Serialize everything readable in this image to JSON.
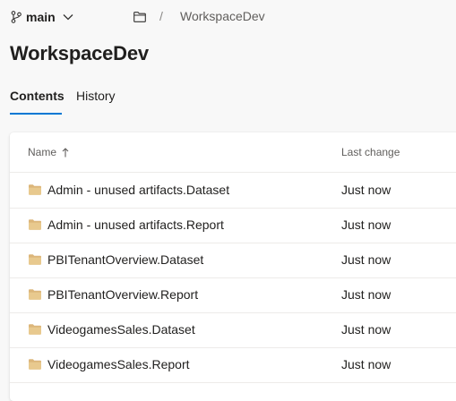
{
  "topbar": {
    "branch_icon": "git-branch-icon",
    "branch": "main",
    "branch_chevron_icon": "chevron-down-icon",
    "folder_icon": "folder-outline-icon",
    "separator": "/",
    "breadcrumb": "WorkspaceDev"
  },
  "page": {
    "title": "WorkspaceDev"
  },
  "tabs": [
    {
      "label": "Contents",
      "active": true
    },
    {
      "label": "History",
      "active": false
    }
  ],
  "table": {
    "columns": [
      {
        "label": "Name",
        "sort": "ascending",
        "sort_icon": "arrow-up-icon"
      },
      {
        "label": "Last change"
      }
    ],
    "rows": [
      {
        "icon": "folder-icon",
        "name": "Admin - unused artifacts.Dataset",
        "last_change": "Just now"
      },
      {
        "icon": "folder-icon",
        "name": "Admin - unused artifacts.Report",
        "last_change": "Just now"
      },
      {
        "icon": "folder-icon",
        "name": "PBITenantOverview.Dataset",
        "last_change": "Just now"
      },
      {
        "icon": "folder-icon",
        "name": "PBITenantOverview.Report",
        "last_change": "Just now"
      },
      {
        "icon": "folder-icon",
        "name": "VideogamesSales.Dataset",
        "last_change": "Just now"
      },
      {
        "icon": "folder-icon",
        "name": "VideogamesSales.Report",
        "last_change": "Just now"
      }
    ]
  },
  "colors": {
    "accent": "#0078d4",
    "folder": "#dcb67a",
    "background": "#f8f8f8",
    "card": "#ffffff"
  }
}
